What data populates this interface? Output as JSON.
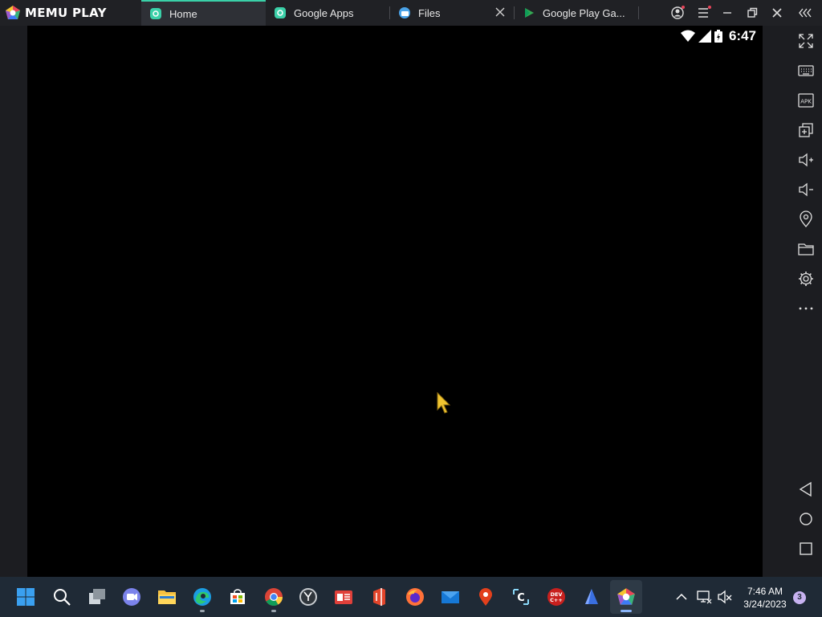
{
  "app": {
    "name": "MEMU PLAY"
  },
  "tabs": [
    {
      "label": "Home",
      "active": true
    },
    {
      "label": "Google Apps",
      "active": false
    },
    {
      "label": "Files",
      "active": false
    },
    {
      "label": "Google Play Ga...",
      "active": false
    }
  ],
  "window_controls": [
    "account-icon",
    "menu-icon",
    "minimize-icon",
    "restore-icon",
    "close-icon",
    "collapse-sidebar-icon"
  ],
  "android_status": {
    "time": "6:47"
  },
  "sidebar_tools": [
    "fullscreen-icon",
    "keyboard-icon",
    "apk-icon",
    "multi-instance-icon",
    "volume-up-icon",
    "volume-down-icon",
    "location-icon",
    "folder-icon",
    "settings-icon",
    "more-icon",
    "back-icon",
    "home-icon",
    "recents-icon"
  ],
  "taskbar": {
    "time": "7:46 AM",
    "date": "3/24/2023",
    "notification_count": "3"
  },
  "colors": {
    "accent": "#3ad0a8",
    "titlebar": "#202125",
    "screen": "#000000",
    "taskbar": "#1f2a36"
  }
}
